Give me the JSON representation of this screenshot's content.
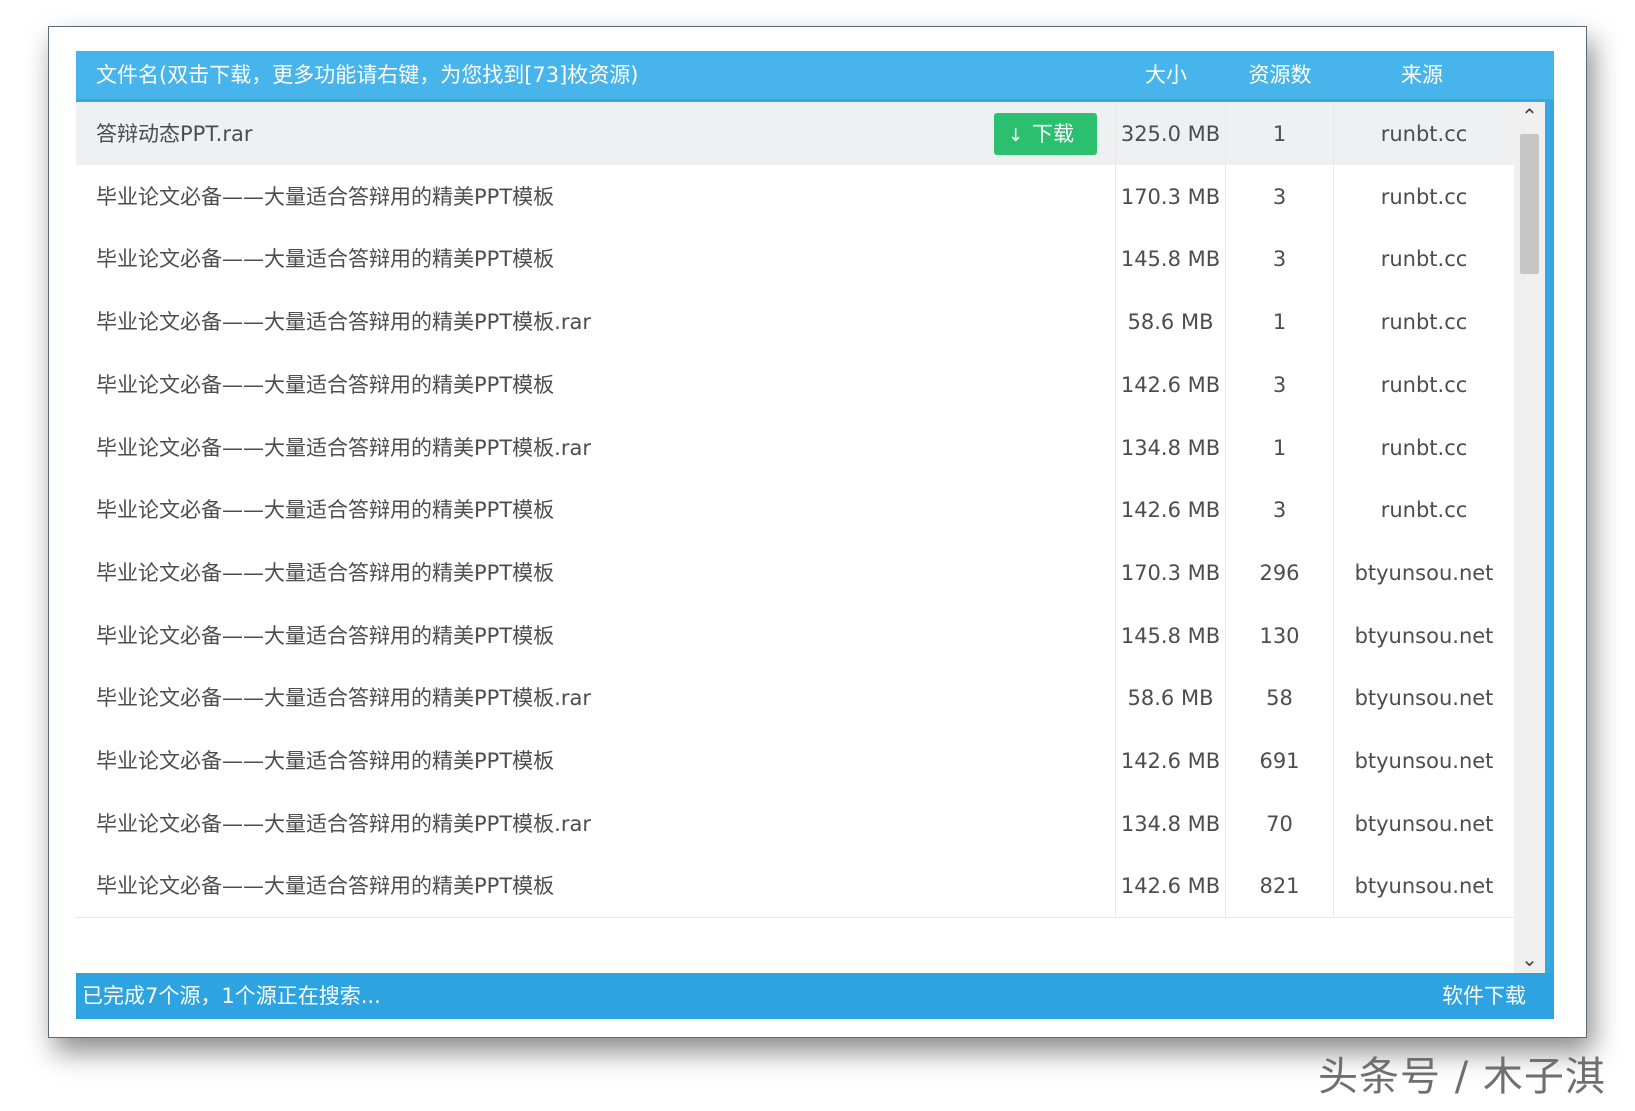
{
  "header": {
    "name_col": "文件名(双击下载，更多功能请右键，为您找到[73]枚资源)",
    "size_col": "大小",
    "count_col": "资源数",
    "source_col": "来源"
  },
  "download_button": {
    "label": "下载",
    "icon": "download-arrow-icon"
  },
  "rows": [
    {
      "name": "答辩动态PPT.rar",
      "size": "325.0 MB",
      "count": "1",
      "source": "runbt.cc",
      "selected": true
    },
    {
      "name": "毕业论文必备——大量适合答辩用的精美PPT模板",
      "size": "170.3 MB",
      "count": "3",
      "source": "runbt.cc"
    },
    {
      "name": "毕业论文必备——大量适合答辩用的精美PPT模板",
      "size": "145.8 MB",
      "count": "3",
      "source": "runbt.cc"
    },
    {
      "name": "毕业论文必备——大量适合答辩用的精美PPT模板.rar",
      "size": "58.6 MB",
      "count": "1",
      "source": "runbt.cc"
    },
    {
      "name": "毕业论文必备——大量适合答辩用的精美PPT模板",
      "size": "142.6 MB",
      "count": "3",
      "source": "runbt.cc"
    },
    {
      "name": "毕业论文必备——大量适合答辩用的精美PPT模板.rar",
      "size": "134.8 MB",
      "count": "1",
      "source": "runbt.cc"
    },
    {
      "name": "毕业论文必备——大量适合答辩用的精美PPT模板",
      "size": "142.6 MB",
      "count": "3",
      "source": "runbt.cc"
    },
    {
      "name": "毕业论文必备——大量适合答辩用的精美PPT模板",
      "size": "170.3 MB",
      "count": "296",
      "source": "btyunsou.net"
    },
    {
      "name": "毕业论文必备——大量适合答辩用的精美PPT模板",
      "size": "145.8 MB",
      "count": "130",
      "source": "btyunsou.net"
    },
    {
      "name": "毕业论文必备——大量适合答辩用的精美PPT模板.rar",
      "size": "58.6 MB",
      "count": "58",
      "source": "btyunsou.net"
    },
    {
      "name": "毕业论文必备——大量适合答辩用的精美PPT模板",
      "size": "142.6 MB",
      "count": "691",
      "source": "btyunsou.net"
    },
    {
      "name": "毕业论文必备——大量适合答辩用的精美PPT模板.rar",
      "size": "134.8 MB",
      "count": "70",
      "source": "btyunsou.net"
    },
    {
      "name": "毕业论文必备——大量适合答辩用的精美PPT模板",
      "size": "142.6 MB",
      "count": "821",
      "source": "btyunsou.net"
    }
  ],
  "status": {
    "left": "已完成7个源，1个源正在搜索...",
    "right": "软件下载"
  },
  "watermark": "头条号 / 木子淇",
  "colors": {
    "header_bg": "#48b4ec",
    "status_bg": "#2ea3e1",
    "button_bg": "#2bc06f"
  }
}
